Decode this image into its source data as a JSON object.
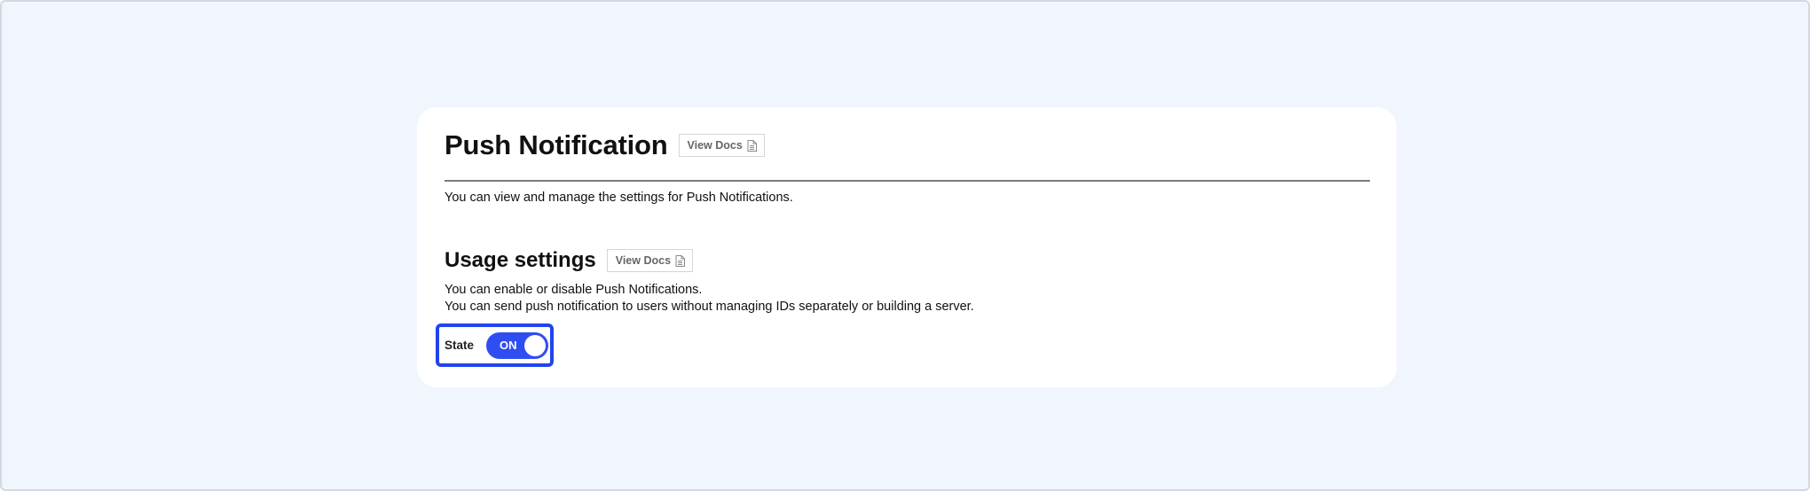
{
  "header": {
    "title": "Push Notification",
    "docs_label": "View Docs",
    "intro": "You can view and manage the settings for Push Notifications."
  },
  "usage": {
    "title": "Usage settings",
    "docs_label": "View Docs",
    "lines": [
      "You can enable or disable Push Notifications.",
      "You can send push notification to users without managing IDs separately or building a server."
    ],
    "state_label": "State",
    "toggle_value": "ON"
  },
  "icons": {
    "docs": "document-icon"
  },
  "colors": {
    "background": "#f1f5fe",
    "accent": "#2f4ef2",
    "focus_ring": "#2244ee"
  }
}
